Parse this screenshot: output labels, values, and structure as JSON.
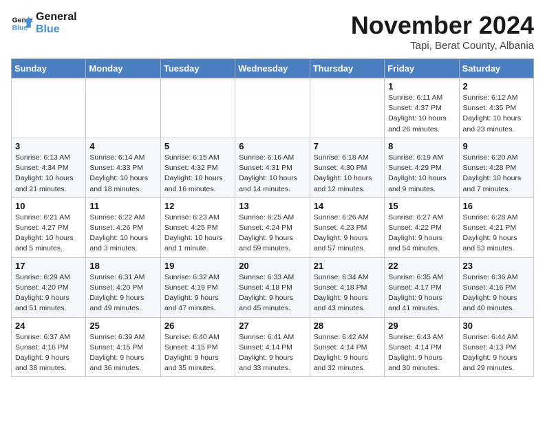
{
  "logo": {
    "line1": "General",
    "line2": "Blue"
  },
  "title": "November 2024",
  "location": "Tapi, Berat County, Albania",
  "days_of_week": [
    "Sunday",
    "Monday",
    "Tuesday",
    "Wednesday",
    "Thursday",
    "Friday",
    "Saturday"
  ],
  "weeks": [
    [
      {
        "day": "",
        "info": ""
      },
      {
        "day": "",
        "info": ""
      },
      {
        "day": "",
        "info": ""
      },
      {
        "day": "",
        "info": ""
      },
      {
        "day": "",
        "info": ""
      },
      {
        "day": "1",
        "info": "Sunrise: 6:11 AM\nSunset: 4:37 PM\nDaylight: 10 hours and 26 minutes."
      },
      {
        "day": "2",
        "info": "Sunrise: 6:12 AM\nSunset: 4:35 PM\nDaylight: 10 hours and 23 minutes."
      }
    ],
    [
      {
        "day": "3",
        "info": "Sunrise: 6:13 AM\nSunset: 4:34 PM\nDaylight: 10 hours and 21 minutes."
      },
      {
        "day": "4",
        "info": "Sunrise: 6:14 AM\nSunset: 4:33 PM\nDaylight: 10 hours and 18 minutes."
      },
      {
        "day": "5",
        "info": "Sunrise: 6:15 AM\nSunset: 4:32 PM\nDaylight: 10 hours and 16 minutes."
      },
      {
        "day": "6",
        "info": "Sunrise: 6:16 AM\nSunset: 4:31 PM\nDaylight: 10 hours and 14 minutes."
      },
      {
        "day": "7",
        "info": "Sunrise: 6:18 AM\nSunset: 4:30 PM\nDaylight: 10 hours and 12 minutes."
      },
      {
        "day": "8",
        "info": "Sunrise: 6:19 AM\nSunset: 4:29 PM\nDaylight: 10 hours and 9 minutes."
      },
      {
        "day": "9",
        "info": "Sunrise: 6:20 AM\nSunset: 4:28 PM\nDaylight: 10 hours and 7 minutes."
      }
    ],
    [
      {
        "day": "10",
        "info": "Sunrise: 6:21 AM\nSunset: 4:27 PM\nDaylight: 10 hours and 5 minutes."
      },
      {
        "day": "11",
        "info": "Sunrise: 6:22 AM\nSunset: 4:26 PM\nDaylight: 10 hours and 3 minutes."
      },
      {
        "day": "12",
        "info": "Sunrise: 6:23 AM\nSunset: 4:25 PM\nDaylight: 10 hours and 1 minute."
      },
      {
        "day": "13",
        "info": "Sunrise: 6:25 AM\nSunset: 4:24 PM\nDaylight: 9 hours and 59 minutes."
      },
      {
        "day": "14",
        "info": "Sunrise: 6:26 AM\nSunset: 4:23 PM\nDaylight: 9 hours and 57 minutes."
      },
      {
        "day": "15",
        "info": "Sunrise: 6:27 AM\nSunset: 4:22 PM\nDaylight: 9 hours and 54 minutes."
      },
      {
        "day": "16",
        "info": "Sunrise: 6:28 AM\nSunset: 4:21 PM\nDaylight: 9 hours and 53 minutes."
      }
    ],
    [
      {
        "day": "17",
        "info": "Sunrise: 6:29 AM\nSunset: 4:20 PM\nDaylight: 9 hours and 51 minutes."
      },
      {
        "day": "18",
        "info": "Sunrise: 6:31 AM\nSunset: 4:20 PM\nDaylight: 9 hours and 49 minutes."
      },
      {
        "day": "19",
        "info": "Sunrise: 6:32 AM\nSunset: 4:19 PM\nDaylight: 9 hours and 47 minutes."
      },
      {
        "day": "20",
        "info": "Sunrise: 6:33 AM\nSunset: 4:18 PM\nDaylight: 9 hours and 45 minutes."
      },
      {
        "day": "21",
        "info": "Sunrise: 6:34 AM\nSunset: 4:18 PM\nDaylight: 9 hours and 43 minutes."
      },
      {
        "day": "22",
        "info": "Sunrise: 6:35 AM\nSunset: 4:17 PM\nDaylight: 9 hours and 41 minutes."
      },
      {
        "day": "23",
        "info": "Sunrise: 6:36 AM\nSunset: 4:16 PM\nDaylight: 9 hours and 40 minutes."
      }
    ],
    [
      {
        "day": "24",
        "info": "Sunrise: 6:37 AM\nSunset: 4:16 PM\nDaylight: 9 hours and 38 minutes."
      },
      {
        "day": "25",
        "info": "Sunrise: 6:39 AM\nSunset: 4:15 PM\nDaylight: 9 hours and 36 minutes."
      },
      {
        "day": "26",
        "info": "Sunrise: 6:40 AM\nSunset: 4:15 PM\nDaylight: 9 hours and 35 minutes."
      },
      {
        "day": "27",
        "info": "Sunrise: 6:41 AM\nSunset: 4:14 PM\nDaylight: 9 hours and 33 minutes."
      },
      {
        "day": "28",
        "info": "Sunrise: 6:42 AM\nSunset: 4:14 PM\nDaylight: 9 hours and 32 minutes."
      },
      {
        "day": "29",
        "info": "Sunrise: 6:43 AM\nSunset: 4:14 PM\nDaylight: 9 hours and 30 minutes."
      },
      {
        "day": "30",
        "info": "Sunrise: 6:44 AM\nSunset: 4:13 PM\nDaylight: 9 hours and 29 minutes."
      }
    ]
  ]
}
